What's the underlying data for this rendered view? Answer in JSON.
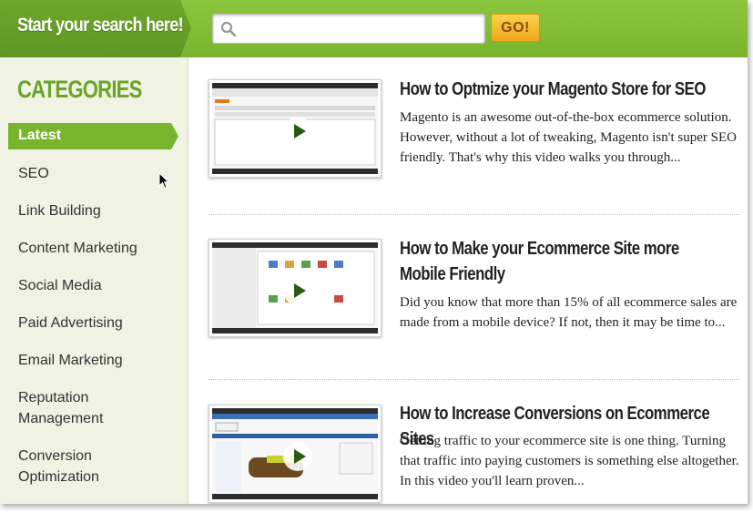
{
  "header": {
    "brand_label": "Start your search here!",
    "search": {
      "value": "",
      "placeholder": ""
    },
    "go_label": "GO!"
  },
  "sidebar": {
    "title": "CATEGORIES",
    "items": [
      {
        "label": "Latest",
        "active": true
      },
      {
        "label": "SEO"
      },
      {
        "label": "Link Building"
      },
      {
        "label": "Content Marketing"
      },
      {
        "label": "Social Media"
      },
      {
        "label": "Paid Advertising"
      },
      {
        "label": "Email Marketing"
      },
      {
        "label": "Reputation Management"
      },
      {
        "label": "Conversion Optimization"
      }
    ]
  },
  "articles": [
    {
      "title": "How to Optmize your Magento Store for SEO",
      "description": "Magento is an awesome out-of-the-box ecommerce solution. However, without a lot of tweaking, Magento isn't super SEO friendly. That's why this video walks you through...",
      "thumbnail_icon": "play-icon"
    },
    {
      "title": "How to Make your Ecommerce Site more Mobile Friendly",
      "description": "Did you know that more than 15% of all ecommerce sales are made from a mobile device? If not, then it may be time to...",
      "thumbnail_icon": "play-icon"
    },
    {
      "title": "How to Increase Conversions on Ecommerce Sites",
      "description": "Getting traffic to your ecommerce site is one thing. Turning that traffic into paying customers is something else altogether. In this video you'll learn proven...",
      "thumbnail_icon": "play-icon"
    }
  ],
  "colors": {
    "brand_green": "#79b52c",
    "go_orange": "#efa81c",
    "sidebar_bg": "#f0f2e4",
    "category_title": "#6ba42a"
  }
}
